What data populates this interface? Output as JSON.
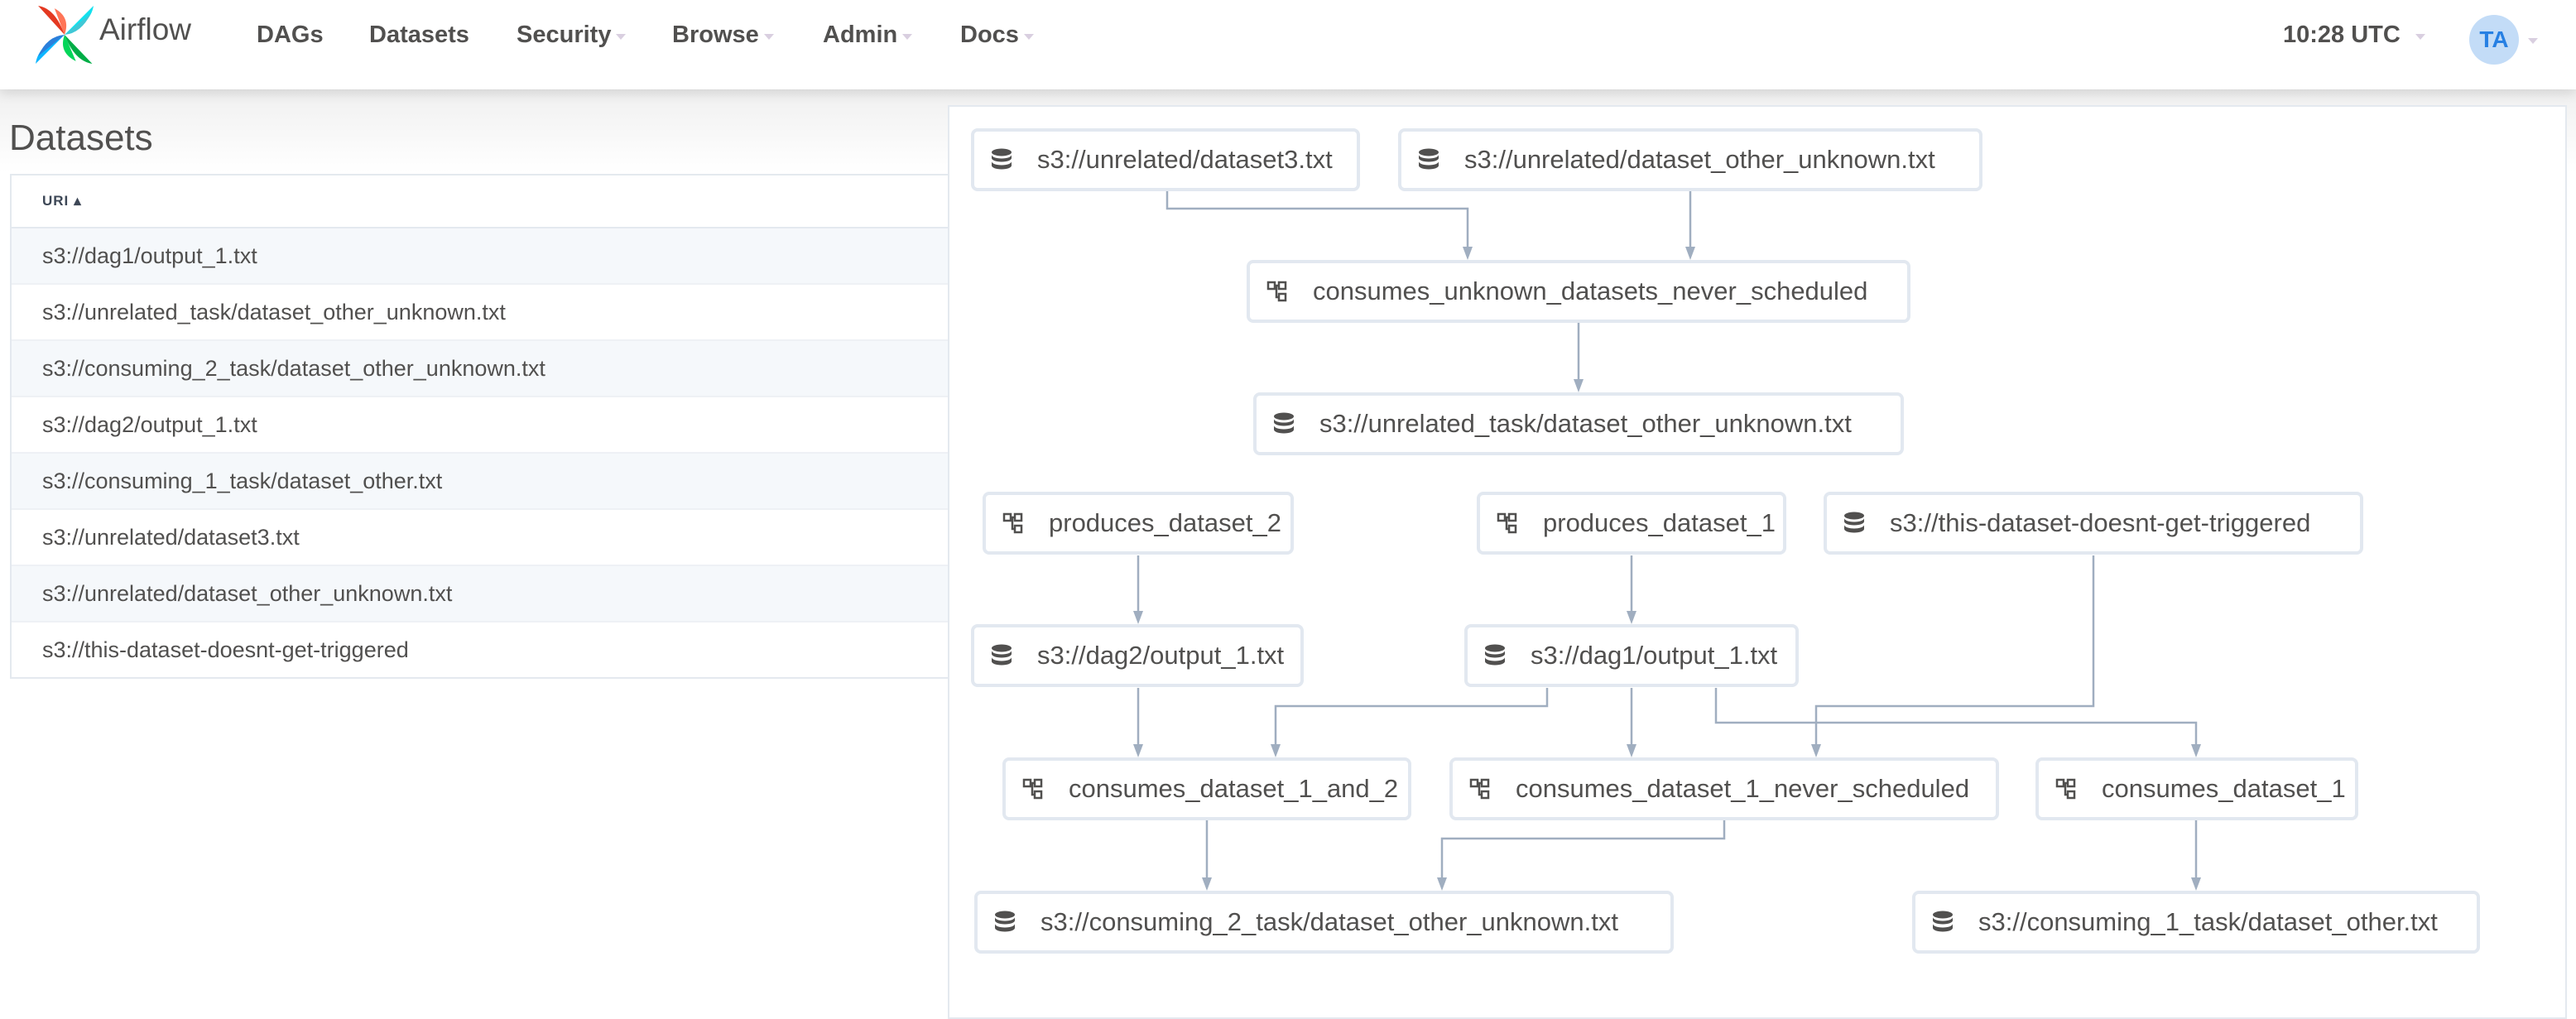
{
  "app": {
    "brand": "Airflow"
  },
  "nav": {
    "items": [
      {
        "label": "DAGs",
        "dropdown": false
      },
      {
        "label": "Datasets",
        "dropdown": false
      },
      {
        "label": "Security",
        "dropdown": true
      },
      {
        "label": "Browse",
        "dropdown": true
      },
      {
        "label": "Admin",
        "dropdown": true
      },
      {
        "label": "Docs",
        "dropdown": true
      }
    ],
    "clock": "10:28 UTC",
    "user_initials": "TA"
  },
  "page": {
    "title": "Datasets"
  },
  "table": {
    "columns": [
      {
        "label": "URI",
        "sortable": true
      }
    ],
    "rows": [
      "s3://dag1/output_1.txt",
      "s3://unrelated_task/dataset_other_unknown.txt",
      "s3://consuming_2_task/dataset_other_unknown.txt",
      "s3://dag2/output_1.txt",
      "s3://consuming_1_task/dataset_other.txt",
      "s3://unrelated/dataset3.txt",
      "s3://unrelated/dataset_other_unknown.txt",
      "s3://this-dataset-doesnt-get-triggered"
    ]
  },
  "graph": {
    "nodes": [
      {
        "id": "n1",
        "type": "dataset",
        "label": "s3://unrelated/dataset3.txt"
      },
      {
        "id": "n2",
        "type": "dataset",
        "label": "s3://unrelated/dataset_other_unknown.txt"
      },
      {
        "id": "n3",
        "type": "dag",
        "label": "consumes_unknown_datasets_never_scheduled"
      },
      {
        "id": "n4",
        "type": "dataset",
        "label": "s3://unrelated_task/dataset_other_unknown.txt"
      },
      {
        "id": "n5",
        "type": "dag",
        "label": "produces_dataset_2"
      },
      {
        "id": "n6",
        "type": "dag",
        "label": "produces_dataset_1"
      },
      {
        "id": "n7",
        "type": "dataset",
        "label": "s3://this-dataset-doesnt-get-triggered"
      },
      {
        "id": "n8",
        "type": "dataset",
        "label": "s3://dag2/output_1.txt"
      },
      {
        "id": "n9",
        "type": "dataset",
        "label": "s3://dag1/output_1.txt"
      },
      {
        "id": "n10",
        "type": "dag",
        "label": "consumes_dataset_1_and_2"
      },
      {
        "id": "n11",
        "type": "dag",
        "label": "consumes_dataset_1_never_scheduled"
      },
      {
        "id": "n12",
        "type": "dag",
        "label": "consumes_dataset_1"
      },
      {
        "id": "n13",
        "type": "dataset",
        "label": "s3://consuming_2_task/dataset_other_unknown.txt"
      },
      {
        "id": "n14",
        "type": "dataset",
        "label": "s3://consuming_1_task/dataset_other.txt"
      }
    ],
    "edges": [
      [
        "n1",
        "n3"
      ],
      [
        "n2",
        "n3"
      ],
      [
        "n3",
        "n4"
      ],
      [
        "n5",
        "n8"
      ],
      [
        "n6",
        "n9"
      ],
      [
        "n8",
        "n10"
      ],
      [
        "n9",
        "n10"
      ],
      [
        "n9",
        "n11"
      ],
      [
        "n9",
        "n12"
      ],
      [
        "n7",
        "n11"
      ],
      [
        "n10",
        "n13"
      ],
      [
        "n11",
        "n13"
      ],
      [
        "n12",
        "n14"
      ]
    ]
  }
}
